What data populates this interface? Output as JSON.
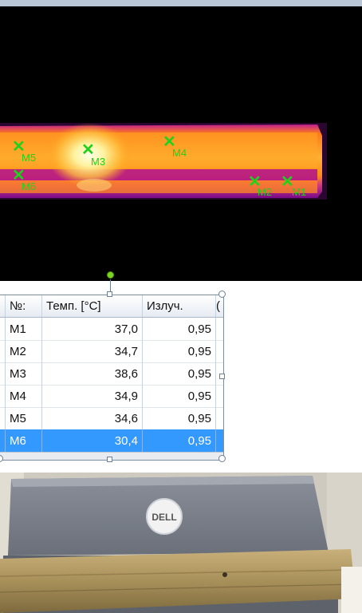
{
  "measurement_markers": [
    {
      "id": "M1"
    },
    {
      "id": "M2"
    },
    {
      "id": "M3"
    },
    {
      "id": "M4"
    },
    {
      "id": "M5"
    },
    {
      "id": "M6"
    }
  ],
  "table": {
    "headers": [
      "№:",
      "Темп. [°C]",
      "Излуч.",
      "("
    ],
    "rows": [
      {
        "num": "M1",
        "temp": "37,0",
        "emiss": "0,95"
      },
      {
        "num": "M2",
        "temp": "34,7",
        "emiss": "0,95"
      },
      {
        "num": "M3",
        "temp": "38,6",
        "emiss": "0,95"
      },
      {
        "num": "M4",
        "temp": "34,9",
        "emiss": "0,95"
      },
      {
        "num": "M5",
        "temp": "34,6",
        "emiss": "0,95"
      },
      {
        "num": "M6",
        "temp": "30,4",
        "emiss": "0,95",
        "selected": true
      }
    ]
  },
  "colors": {
    "marker": "#22d11b",
    "selection": "#3399ff",
    "hot_core": "#fffbd0",
    "hot_body": "#ff9b1a",
    "cool_edge": "#b0108e"
  },
  "photo": {
    "logo_text": "DELL"
  }
}
